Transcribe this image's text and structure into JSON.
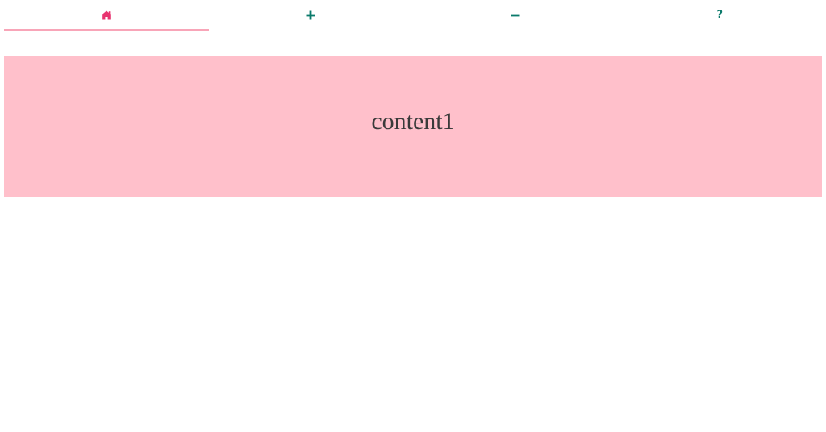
{
  "tabs": [
    {
      "id": "home",
      "icon": "home-icon",
      "active": true
    },
    {
      "id": "add",
      "icon": "plus-icon",
      "active": false
    },
    {
      "id": "remove",
      "icon": "minus-icon",
      "active": false
    },
    {
      "id": "help",
      "icon": "question-icon",
      "glyph": "?",
      "active": false
    }
  ],
  "colors": {
    "active_icon": "#e8336f",
    "inactive_icon": "#0b7a6b",
    "active_underline": "#f8a5b8",
    "panel_background": "#ffc0cb",
    "panel_text": "#3a3a3a"
  },
  "panel": {
    "text": "content1"
  }
}
